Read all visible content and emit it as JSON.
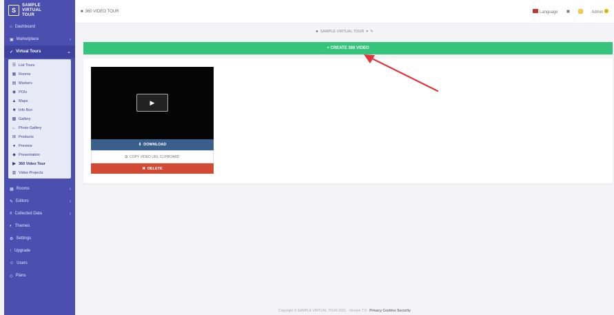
{
  "brand": {
    "logo_text": "S",
    "line1": "SAMPLE",
    "line2": "VIRTUAL",
    "line3": "TOUR"
  },
  "sidebar": {
    "items_top": [
      {
        "label": "Dashboard",
        "icon": "home-icon"
      },
      {
        "label": "Marketplace",
        "icon": "store-icon",
        "caret": true
      },
      {
        "label": "Virtual Tours",
        "icon": "check-icon",
        "caret": true,
        "active": true
      }
    ],
    "submenu": [
      {
        "label": "List Tours",
        "icon": "list-icon"
      },
      {
        "label": "Rooms",
        "icon": "room-icon"
      },
      {
        "label": "Markers",
        "icon": "marker-icon"
      },
      {
        "label": "POIs",
        "icon": "poi-icon"
      },
      {
        "label": "Maps",
        "icon": "map-icon"
      },
      {
        "label": "Info Box",
        "icon": "info-icon"
      },
      {
        "label": "Gallery",
        "icon": "gallery-icon"
      },
      {
        "label": "Photo Gallery",
        "icon": "photo-icon"
      },
      {
        "label": "Products",
        "icon": "product-icon"
      },
      {
        "label": "Preview",
        "icon": "preview-icon"
      },
      {
        "label": "Presentation",
        "icon": "presentation-icon"
      },
      {
        "label": "360 Video Tour",
        "icon": "video-icon",
        "current": true
      },
      {
        "label": "Video Projects",
        "icon": "film-icon"
      }
    ],
    "items_bottom": [
      {
        "label": "Rooms",
        "icon": "room-icon",
        "caret": true
      },
      {
        "label": "Editors",
        "icon": "edit-icon",
        "caret": true
      },
      {
        "label": "Collected Data",
        "icon": "data-icon",
        "caret": true
      },
      {
        "label": "Themes",
        "icon": "theme-icon"
      },
      {
        "label": "Settings",
        "icon": "gear-icon"
      },
      {
        "label": "Upgrade",
        "icon": "upgrade-icon"
      },
      {
        "label": "Users",
        "icon": "users-icon"
      },
      {
        "label": "Plans",
        "icon": "plans-icon"
      }
    ]
  },
  "topbar": {
    "title": "360 VIDEO TOUR",
    "language": "Language",
    "user": "Admin"
  },
  "subheader": {
    "tour_selector": "SAMPLE VIRTUAL TOUR",
    "tour_selector_caret": "▾"
  },
  "main": {
    "create_button": "+ CREATE 360 VIDEO",
    "video": {
      "download_label": "DOWNLOAD",
      "copy_label": "COPY VIDEO URL CLIPBOARD",
      "delete_label": "DELETE"
    }
  },
  "footer": {
    "text": "Copyright © SAMPLE VIRTUAL TOUR 2021 - Version 7.0 -",
    "link1": "Privacy",
    "link2": "Cookies",
    "link3": "Security"
  },
  "colors": {
    "sidebar": "#4a4fb0",
    "create_button": "#34c47c",
    "download_button": "#3b5f8c",
    "delete_button": "#d24a34",
    "annotation_arrow": "#e0343c"
  }
}
